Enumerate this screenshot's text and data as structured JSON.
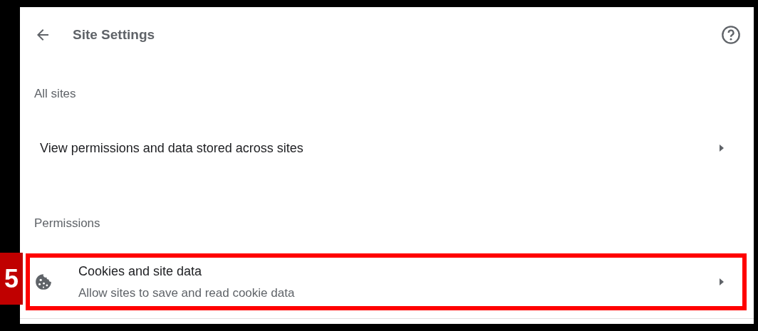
{
  "header": {
    "title": "Site Settings"
  },
  "sections": [
    {
      "heading": "All sites",
      "rows": [
        {
          "title": "View permissions and data stored across sites",
          "kind": "link",
          "highlighted": false
        }
      ]
    },
    {
      "heading": "Permissions",
      "rows": [
        {
          "title": "Cookies and site data",
          "subtitle": "Allow sites to save and read cookie data",
          "kind": "icon-link",
          "highlighted": true
        }
      ]
    }
  ],
  "callout": {
    "step": "5"
  }
}
